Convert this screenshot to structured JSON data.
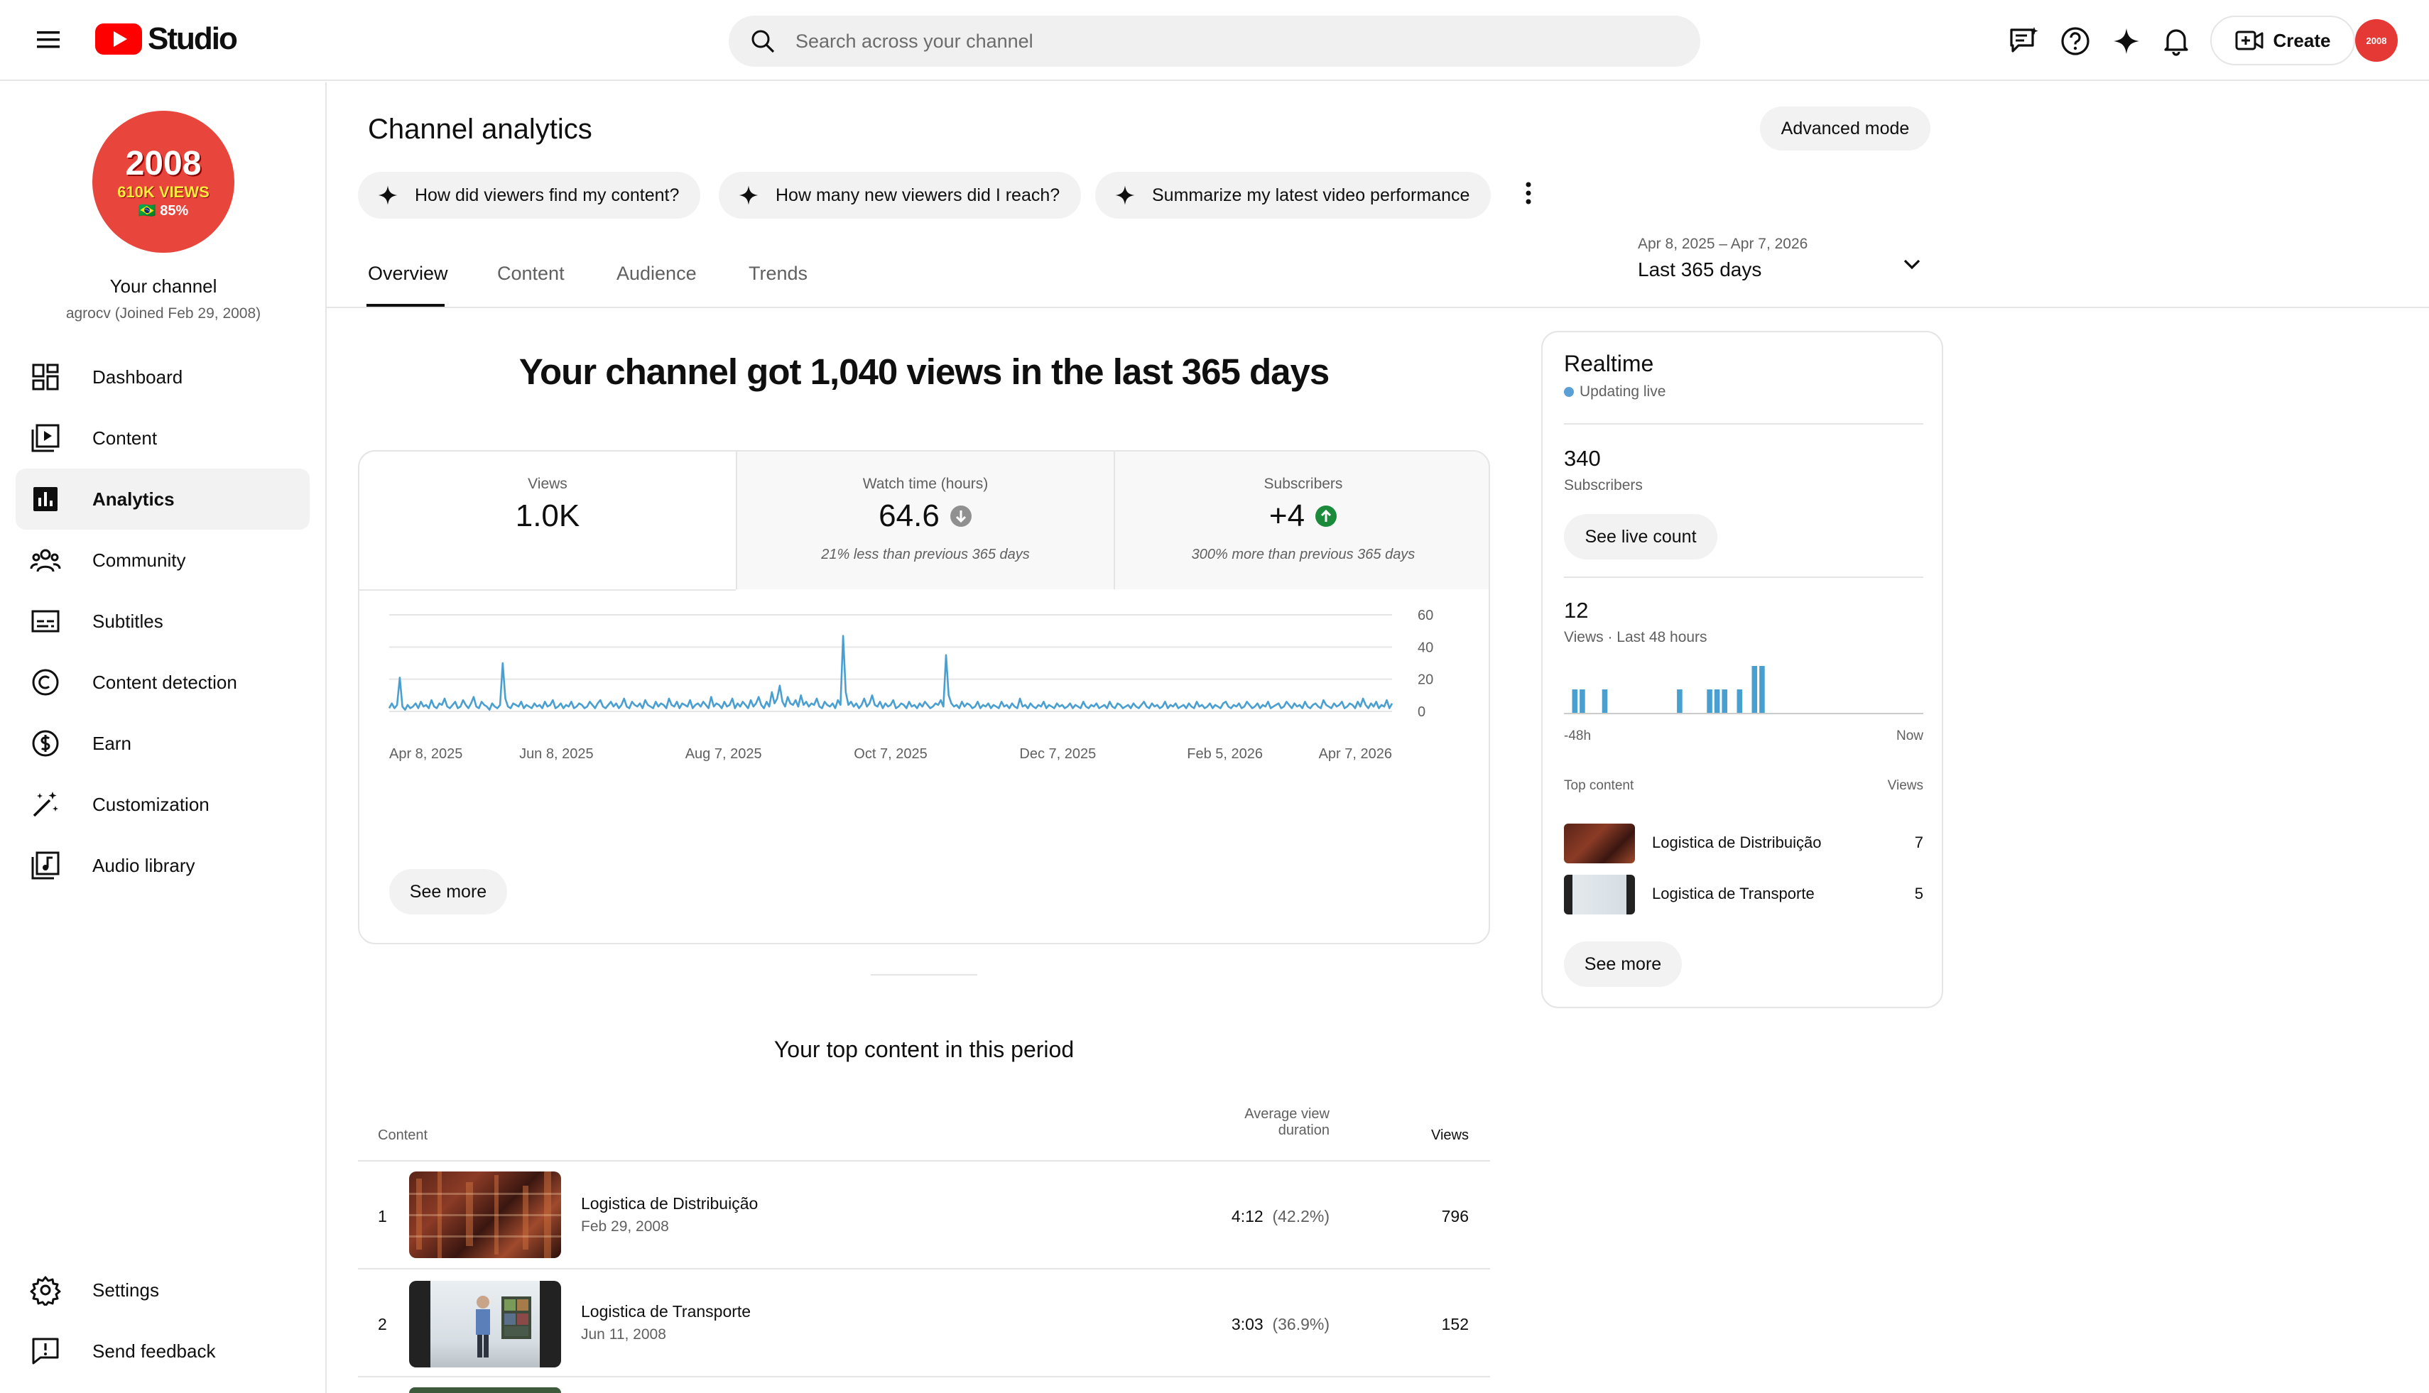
{
  "header": {
    "logo_text": "Studio",
    "search_placeholder": "Search across your channel",
    "create_label": "Create",
    "avatar_text": "2008"
  },
  "sidebar": {
    "avatar": {
      "line1": "2008",
      "line2": "610K VIEWS",
      "line3": "🇧🇷 85%"
    },
    "channel_name": "Your channel",
    "channel_sub": "agrocv (Joined Feb 29, 2008)",
    "items": [
      {
        "label": "Dashboard",
        "icon": "dashboard-icon"
      },
      {
        "label": "Content",
        "icon": "content-icon"
      },
      {
        "label": "Analytics",
        "icon": "analytics-icon",
        "active": true
      },
      {
        "label": "Community",
        "icon": "community-icon"
      },
      {
        "label": "Subtitles",
        "icon": "subtitles-icon"
      },
      {
        "label": "Content detection",
        "icon": "copyright-icon"
      },
      {
        "label": "Earn",
        "icon": "dollar-icon"
      },
      {
        "label": "Customization",
        "icon": "magic-wand-icon"
      },
      {
        "label": "Audio library",
        "icon": "audio-library-icon"
      }
    ],
    "bottom_items": [
      {
        "label": "Settings",
        "icon": "gear-icon"
      },
      {
        "label": "Send feedback",
        "icon": "feedback-icon"
      }
    ]
  },
  "main": {
    "title": "Channel analytics",
    "advanced_mode": "Advanced mode",
    "chips": [
      "How did viewers find my content?",
      "How many new viewers did I reach?",
      "Summarize my latest video performance"
    ],
    "tabs": [
      "Overview",
      "Content",
      "Audience",
      "Trends"
    ],
    "active_tab": "Overview",
    "date_range": "Apr 8, 2025 – Apr 7, 2026",
    "date_label": "Last 365 days",
    "headline": "Your channel got 1,040 views in the last 365 days",
    "metrics": [
      {
        "label": "Views",
        "value": "1.0K",
        "note": ""
      },
      {
        "label": "Watch time (hours)",
        "value": "64.6",
        "note": "21% less than previous 365 days",
        "trend": "down"
      },
      {
        "label": "Subscribers",
        "value": "+4",
        "note": "300% more than previous 365 days",
        "trend": "up"
      }
    ],
    "see_more": "See more",
    "top_content_title": "Your top content in this period",
    "table": {
      "col_content": "Content",
      "col_avd_line1": "Average view",
      "col_avd_line2": "duration",
      "col_views": "Views",
      "rows": [
        {
          "rank": "1",
          "title": "Logistica de Distribuição",
          "date": "Feb 29, 2008",
          "duration": "4:12",
          "pct": "(42.2%)",
          "views": "796"
        },
        {
          "rank": "2",
          "title": "Logistica de Transporte",
          "date": "Jun 11, 2008",
          "duration": "3:03",
          "pct": "(36.9%)",
          "views": "152"
        }
      ]
    }
  },
  "realtime": {
    "title": "Realtime",
    "live": "Updating live",
    "subs_value": "340",
    "subs_label": "Subscribers",
    "see_live_count": "See live count",
    "views_value": "12",
    "views_label": "Views · Last 48 hours",
    "axis_left": "-48h",
    "axis_right": "Now",
    "top_content_label": "Top content",
    "views_col": "Views",
    "rows": [
      {
        "title": "Logistica de Distribuição",
        "views": "7"
      },
      {
        "title": "Logistica de Transporte",
        "views": "5"
      }
    ],
    "see_more": "See more",
    "bars": [
      0,
      1,
      1,
      0,
      0,
      1,
      0,
      0,
      0,
      0,
      0,
      0,
      0,
      0,
      0,
      1,
      0,
      0,
      0,
      1,
      1,
      1,
      0,
      1,
      0,
      2,
      2,
      0,
      0,
      0,
      0,
      0,
      0,
      0,
      0,
      0,
      0,
      0,
      0,
      0,
      0,
      0,
      0,
      0,
      0,
      0,
      0,
      0
    ]
  },
  "chart_data": {
    "type": "line",
    "x_ticks": [
      "Apr 8, 2025",
      "Jun 8, 2025",
      "Aug 7, 2025",
      "Oct 7, 2025",
      "Dec 7, 2025",
      "Feb 5, 2026",
      "Apr 7, 2026"
    ],
    "y_ticks": [
      "60",
      "40",
      "20",
      "0"
    ],
    "ylim": [
      0,
      60
    ],
    "grid": true,
    "color": "#4a9fd1",
    "values": [
      2,
      5,
      2,
      4,
      21,
      3,
      1,
      4,
      2,
      3,
      5,
      2,
      6,
      3,
      4,
      2,
      7,
      3,
      2,
      5,
      4,
      8,
      3,
      2,
      4,
      6,
      2,
      3,
      7,
      4,
      2,
      5,
      9,
      3,
      2,
      6,
      4,
      3,
      1,
      5,
      3,
      2,
      4,
      30,
      8,
      3,
      2,
      5,
      4,
      3,
      6,
      2,
      4,
      3,
      2,
      5,
      3,
      4,
      2,
      6,
      3,
      4,
      7,
      2,
      3,
      5,
      2,
      4,
      3,
      6,
      2,
      3,
      5,
      4,
      2,
      3,
      6,
      4,
      2,
      5,
      7,
      3,
      2,
      4,
      6,
      3,
      5,
      2,
      4,
      8,
      3,
      2,
      6,
      4,
      3,
      5,
      2,
      7,
      4,
      3,
      2,
      6,
      3,
      5,
      4,
      2,
      8,
      4,
      3,
      6,
      2,
      5,
      4,
      3,
      7,
      2,
      4,
      5,
      3,
      6,
      4,
      2,
      9,
      3,
      5,
      4,
      2,
      6,
      3,
      4,
      8,
      2,
      5,
      3,
      6,
      4,
      2,
      7,
      3,
      5,
      9,
      4,
      2,
      6,
      3,
      12,
      5,
      8,
      16,
      6,
      3,
      9,
      5,
      4,
      7,
      3,
      10,
      4,
      6,
      3,
      5,
      4,
      8,
      3,
      2,
      6,
      4,
      3,
      5,
      2,
      7,
      4,
      47,
      12,
      4,
      6,
      3,
      5,
      2,
      4,
      8,
      3,
      5,
      10,
      4,
      3,
      6,
      2,
      5,
      3,
      4,
      7,
      2,
      3,
      5,
      4,
      2,
      6,
      3,
      4,
      2,
      5,
      3,
      6,
      4,
      2,
      3,
      5,
      4,
      7,
      3,
      35,
      10,
      5,
      3,
      4,
      2,
      6,
      3,
      5,
      4,
      2,
      3,
      6,
      2,
      4,
      3,
      5,
      2,
      4,
      3,
      2,
      6,
      3,
      4,
      2,
      5,
      3,
      2,
      8,
      3,
      4,
      2,
      5,
      3,
      2,
      4,
      3,
      6,
      2,
      4,
      3,
      2,
      5,
      3,
      4,
      2,
      3,
      5,
      2,
      4,
      3,
      2,
      6,
      3,
      2,
      4,
      3,
      5,
      2,
      3,
      4,
      2,
      6,
      3,
      2,
      5,
      4,
      2,
      3,
      4,
      2,
      5,
      3,
      2,
      4,
      6,
      3,
      2,
      5,
      3,
      4,
      2,
      3,
      6,
      2,
      4,
      3,
      5,
      2,
      3,
      4,
      2,
      5,
      3,
      2,
      6,
      3,
      4,
      2,
      3,
      5,
      2,
      4,
      3,
      2,
      5,
      6,
      3,
      2,
      4,
      3,
      5,
      2,
      3,
      6,
      4,
      2,
      3,
      5,
      2,
      4,
      3,
      6,
      2,
      3,
      4,
      5,
      2,
      3,
      6,
      4,
      2,
      5,
      3,
      4,
      2,
      6,
      3,
      2,
      4,
      5,
      3,
      2,
      7,
      4,
      3,
      2,
      5,
      3,
      4,
      6,
      2,
      3,
      5,
      4,
      2,
      6,
      3,
      8,
      4,
      2,
      5,
      3,
      6,
      2,
      4,
      3,
      7,
      2,
      5
    ]
  }
}
